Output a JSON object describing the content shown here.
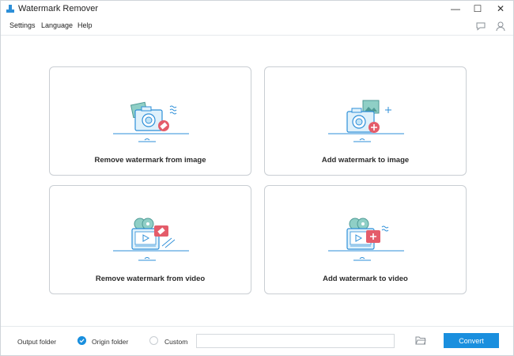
{
  "window": {
    "title": "Watermark Remover",
    "minimize": "—",
    "maximize": "☐",
    "close": "✕"
  },
  "menu": {
    "items": [
      "Settings",
      "Language",
      "Help"
    ]
  },
  "cards": [
    {
      "label": "Remove watermark from image",
      "icon": "remove-image-icon"
    },
    {
      "label": "Add watermark to image",
      "icon": "add-image-icon"
    },
    {
      "label": "Remove watermark from video",
      "icon": "remove-video-icon"
    },
    {
      "label": "Add watermark to video",
      "icon": "add-video-icon"
    }
  ],
  "bottom": {
    "output_label": "Output folder",
    "origin_label": "Origin folder",
    "custom_label": "Custom",
    "path_value": "",
    "convert_label": "Convert",
    "selected": "origin"
  },
  "colors": {
    "accent": "#1a8fde",
    "icon_teal": "#5aa7a7",
    "icon_blue": "#2d8fd8",
    "icon_red": "#e45c6a"
  }
}
